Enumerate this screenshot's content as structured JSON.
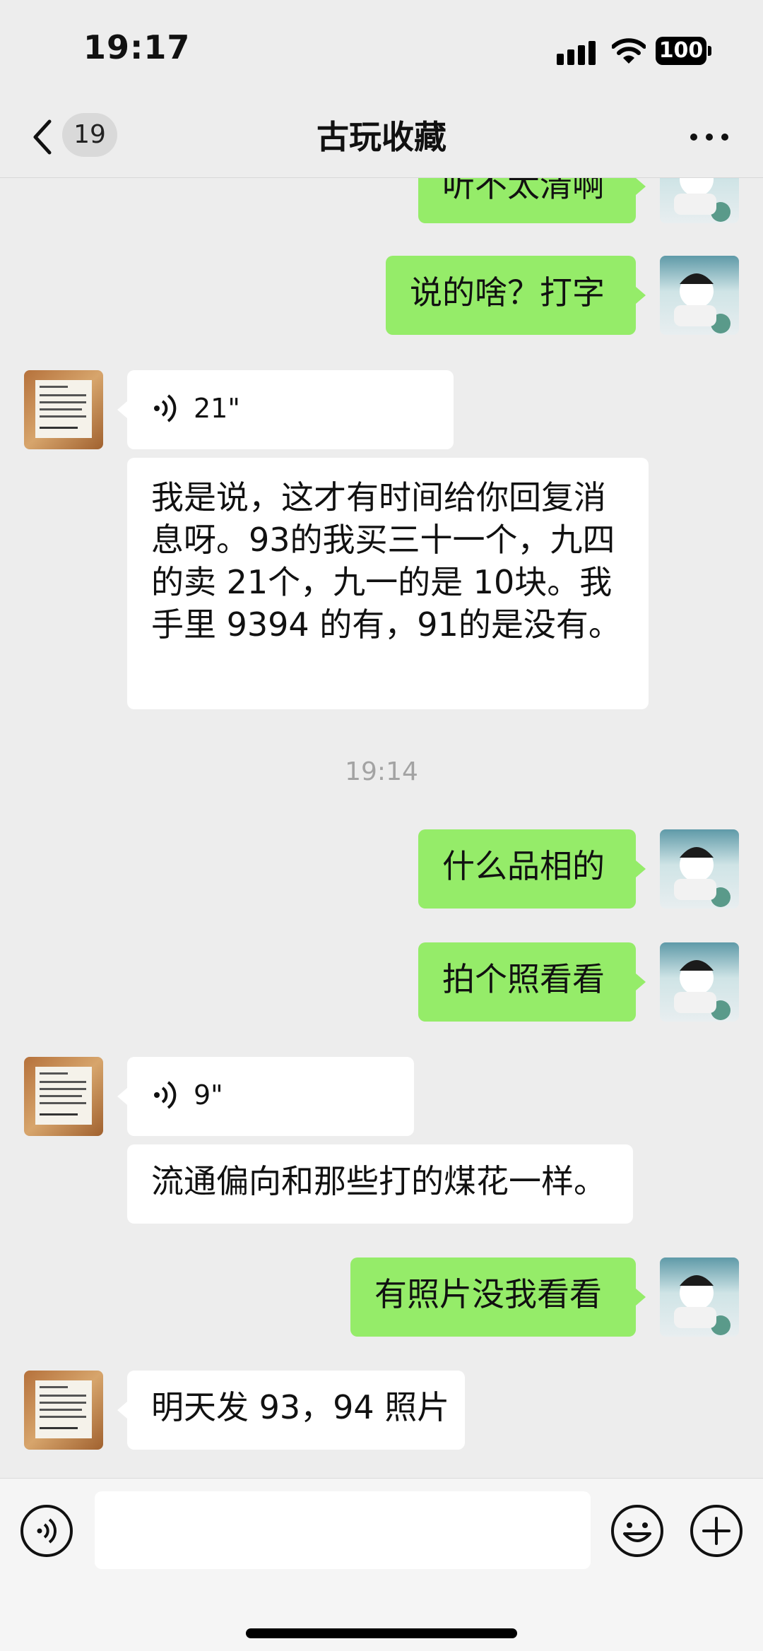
{
  "status_bar": {
    "time": "19:17",
    "battery": "100"
  },
  "header": {
    "unread_count": "19",
    "title": "古玩收藏"
  },
  "messages": [
    {
      "text": "听不太清啊"
    },
    {
      "text": "说的啥？打字"
    },
    {
      "voice_duration": "21\""
    },
    {
      "text": "我是说，这才有时间给你回复消息呀。93的我买三十一个，九四的卖 21个，九一的是 10块。我手里 9394 的有，91的是没有。"
    },
    {
      "time": "19:14"
    },
    {
      "text": "什么品相的"
    },
    {
      "text": "拍个照看看"
    },
    {
      "voice_duration": "9\""
    },
    {
      "text": "流通偏向和那些打的煤花一样。"
    },
    {
      "text": "有照片没我看看"
    },
    {
      "text": "明天发 93，94 照片"
    }
  ],
  "input": {
    "value": "",
    "placeholder": ""
  },
  "colors": {
    "outgoing_bubble": "#95ec69",
    "incoming_bubble": "#ffffff",
    "background": "#ededed"
  },
  "icons": [
    "back-icon",
    "more-icon",
    "voice-wave-icon",
    "voice-input-icon",
    "emoji-icon",
    "plus-icon",
    "signal-icon",
    "wifi-icon",
    "battery-icon"
  ]
}
